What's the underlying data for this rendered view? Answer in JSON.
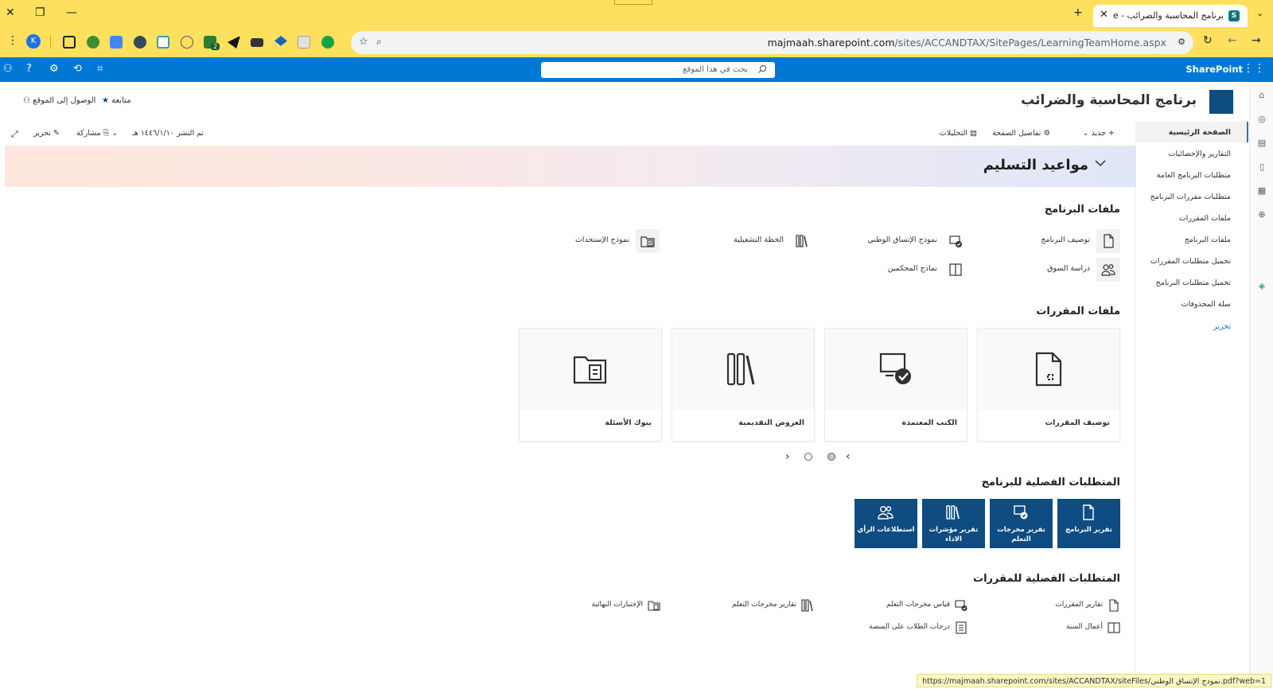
{
  "browser": {
    "tab_title": "برنامج المحاسبة والضرائب - Home",
    "tab_favicon": "S",
    "url_host": "majmaah.sharepoint.com",
    "url_path": "/sites/ACCANDTAX/SitePages/LearningTeamHome.aspx",
    "profile_initial": "K",
    "extension_badge": "2"
  },
  "suite": {
    "brand": "SharePoint",
    "search_placeholder": "بحث في هذا الموقع"
  },
  "site": {
    "title": "برنامج المحاسبة والضرائب",
    "follow_label": "متابعة",
    "site_access_label": "الوصول إلى الموقع"
  },
  "nav": {
    "items": [
      {
        "label": "الصفحة الرئيسية",
        "active": true
      },
      {
        "label": "التقارير والإحصائيات"
      },
      {
        "label": "متطلبات البرنامج العامة"
      },
      {
        "label": "متطلبات مقررات البرنامج"
      },
      {
        "label": "ملفات المقررات"
      },
      {
        "label": "ملفات البرنامج"
      },
      {
        "label": "تحميل متطلبات المقررات"
      },
      {
        "label": "تحميل متطلبات البرنامج"
      },
      {
        "label": "سلة المحذوفات"
      }
    ],
    "edit_label": "تحرير"
  },
  "commandbar": {
    "new_label": "جديد",
    "page_details_label": "تفاصيل الصفحة",
    "analytics_label": "التحليلات",
    "published_label": "تم النشر ١٤٤٦/١/١٠ هـ",
    "share_label": "مشاركة",
    "edit_label": "تحرير"
  },
  "banner": {
    "title": "مواعيد التسليم"
  },
  "program_files": {
    "heading": "ملفات البرنامج",
    "links": [
      {
        "label": "توصيف البرنامج",
        "icon": "document-icon"
      },
      {
        "label": "نموذج الإتساق الوطني",
        "icon": "certificate-icon"
      },
      {
        "label": "الخطة التشغيلية",
        "icon": "library-icon"
      },
      {
        "label": "نموذج الإستحداث",
        "icon": "folder-list-icon"
      },
      {
        "label": "دراسة السوق",
        "icon": "people-icon"
      },
      {
        "label": "نماذج المحكمين",
        "icon": "book-icon"
      }
    ]
  },
  "course_files": {
    "heading": "ملفات المقررات",
    "cards": [
      {
        "label": "توصيف المقررات",
        "icon": "document-icon"
      },
      {
        "label": "الكتب المعتمدة",
        "icon": "certificate-icon"
      },
      {
        "label": "العروض التقديمية",
        "icon": "library-icon"
      },
      {
        "label": "بنوك الأسئلة",
        "icon": "folder-list-icon"
      }
    ]
  },
  "program_requirements": {
    "heading": "المتطلبات الفصلية للبرنامج",
    "tiles": [
      {
        "label": "تقرير البرنامج",
        "icon": "document-icon"
      },
      {
        "label": "تقرير مخرجات التعلم",
        "icon": "certificate-icon"
      },
      {
        "label": "تقرير مؤشرات الاداء",
        "icon": "library-icon"
      },
      {
        "label": "استطلاعات الرأي",
        "icon": "people-icon"
      }
    ]
  },
  "course_requirements": {
    "heading": "المتطلبات الفصلية للمقررات",
    "links": [
      {
        "label": "تقارير المقررات",
        "icon": "document-icon"
      },
      {
        "label": "قياس مخرجات التعلم",
        "icon": "certificate-icon"
      },
      {
        "label": "تقارير مخرجات التعلم",
        "icon": "library-icon"
      },
      {
        "label": "الإختبارات النهائية",
        "icon": "folder-list-icon"
      },
      {
        "label": "أعمال السنة",
        "icon": "book-icon"
      },
      {
        "label": "درجات الطلاب على المنصة",
        "icon": "grades-icon"
      }
    ]
  },
  "status_url": "https://majmaah.sharepoint.com/sites/ACCANDTAX/siteFiles/نموذج الإتساق الوطني.pdf?web=1",
  "colors": {
    "browser_chrome": "#fde05e",
    "suite_bar": "#0078d4",
    "tile_blue": "#0f4c81"
  }
}
